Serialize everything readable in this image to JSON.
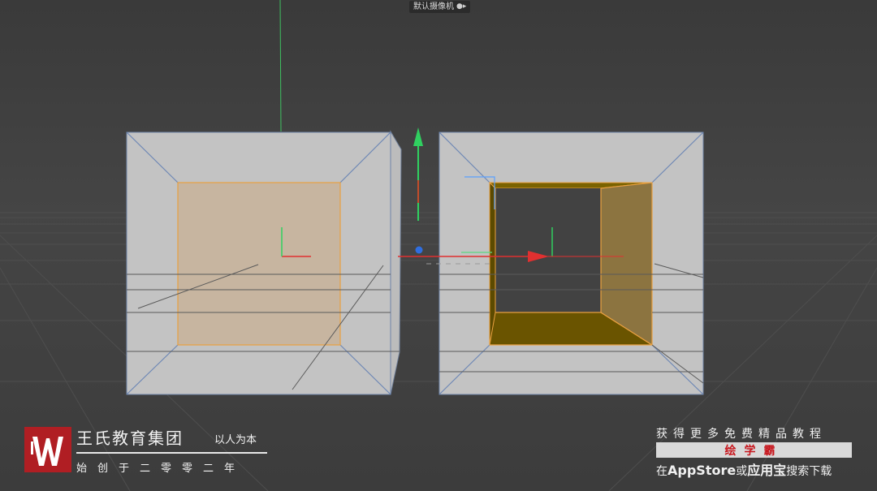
{
  "viewport": {
    "camera_label": "默认摄像机",
    "camera_icon": "camera-icon",
    "objects": [
      {
        "name": "left-cube",
        "selection": "front-face"
      },
      {
        "name": "right-cube",
        "selection": "inner-hole-faces"
      }
    ]
  },
  "branding": {
    "name": "王氏教育集团",
    "motto": "以人为本",
    "since": "始创于二零零二年"
  },
  "promo": {
    "line1": "获得更多免费精品教程",
    "highlight": "绘学霸",
    "line3_prefix": "在",
    "line3_store": "AppStore",
    "line3_or": "或",
    "line3_app": "应用宝",
    "line3_suffix": "搜索下载"
  },
  "colors": {
    "background": "#3f3f3f",
    "selection_orange": "#e8a040",
    "axis_x": "#e03030",
    "axis_y": "#30d060",
    "axis_z": "#3060e0",
    "logo_red": "#b01e23",
    "promo_red": "#c8161d"
  }
}
